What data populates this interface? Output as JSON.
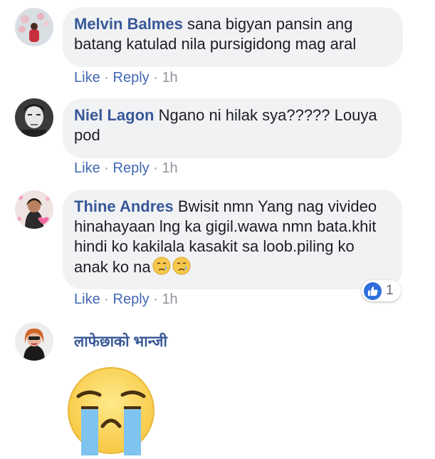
{
  "comments": [
    {
      "author": "Melvin Balmes",
      "text": "sana bigyan pansin ang batang katulad nila pursigidong mag aral",
      "like": "Like",
      "reply": "Reply",
      "time": "1h"
    },
    {
      "author": "Niel Lagon",
      "text": "Ngano ni hilak sya????? Louya pod",
      "like": "Like",
      "reply": "Reply",
      "time": "1h"
    },
    {
      "author": "Thine Andres",
      "text": "Bwisit nmn Yang nag vivideo hinahayaan lng ka gigil.wawa nmn bata.khit hindi ko kakilala kasakit sa loob.piling ko anak ko na",
      "like": "Like",
      "reply": "Reply",
      "time": "1h",
      "reaction_count": "1"
    },
    {
      "author": "लाफेछाको भान्जी"
    }
  ],
  "separator": "·",
  "colors": {
    "author": "#385898",
    "action_link": "#4267b2",
    "timestamp": "#90949c",
    "bubble_bg": "#f1f2f4",
    "like_badge": "#2f6fdb"
  },
  "icons": {
    "reaction": "like-thumb-icon",
    "inline_emoji": "crying-face-emoji",
    "sticker": "crying-face-sticker"
  }
}
